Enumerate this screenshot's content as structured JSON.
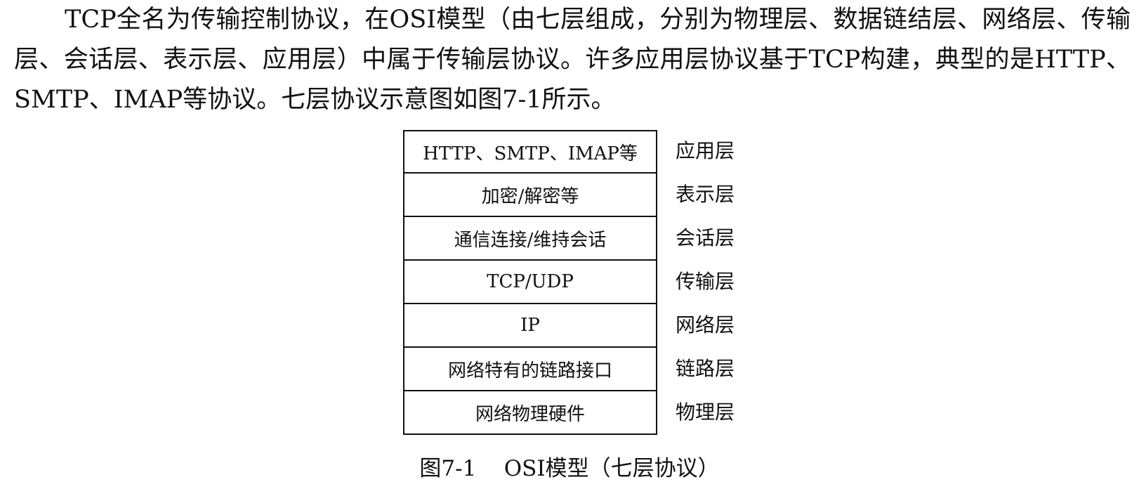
{
  "paragraph": {
    "text": "TCP全名为传输控制协议，在OSI模型（由七层组成，分别为物理层、数据链结层、网络层、传输层、会话层、表示层、应用层）中属于传输层协议。许多应用层协议基于TCP构建，典型的是HTTP、SMTP、IMAP等协议。七层协议示意图如图7-1所示。"
  },
  "diagram": {
    "layers": [
      {
        "content": "HTTP、SMTP、IMAP等",
        "name": "应用层"
      },
      {
        "content": "加密/解密等",
        "name": "表示层"
      },
      {
        "content": "通信连接/维持会话",
        "name": "会话层"
      },
      {
        "content": "TCP/UDP",
        "name": "传输层"
      },
      {
        "content": "IP",
        "name": "网络层"
      },
      {
        "content": "网络特有的链路接口",
        "name": "链路层"
      },
      {
        "content": "网络物理硬件",
        "name": "物理层"
      }
    ]
  },
  "caption": {
    "label": "图7-1",
    "title": "OSI模型（七层协议）"
  }
}
